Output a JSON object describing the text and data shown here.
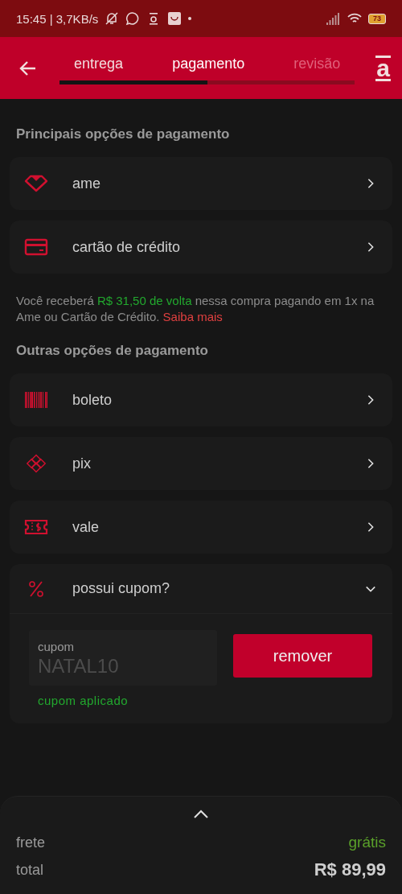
{
  "status_bar": {
    "time": "15:45 | 3,7KB/s",
    "battery": "73"
  },
  "header": {
    "logo": "a",
    "progress": {
      "level": 0.5
    },
    "steps": [
      {
        "label": "entrega",
        "selected": false,
        "disabled": false
      },
      {
        "label": "pagamento",
        "selected": true,
        "disabled": false
      },
      {
        "label": "revisão",
        "selected": false,
        "disabled": true
      }
    ]
  },
  "main_options": {
    "title": "Principais opções de pagamento",
    "items": [
      {
        "kind": "ame",
        "label": "ame"
      },
      {
        "kind": "card",
        "label": "cartão de crédito"
      }
    ]
  },
  "cashback": {
    "before": "Você receberá ",
    "highlight": "R$ 31,50 de volta",
    "after": " nessa compra pagando em 1x na Ame ou Cartão de Crédito.",
    "link": "Saiba mais"
  },
  "other_options": {
    "title": "Outras opções de pagamento",
    "items": [
      {
        "kind": "boleto",
        "label": "boleto"
      },
      {
        "kind": "pix",
        "label": "pix"
      },
      {
        "kind": "vale",
        "label": "vale"
      }
    ]
  },
  "coupon": {
    "label": "possui cupom?",
    "expanded": true,
    "field_label": "cupom",
    "value": "NATAL10",
    "button": "remover",
    "status": "cupom aplicado"
  },
  "summary": {
    "rows": [
      {
        "label": "frete",
        "value": "grátis",
        "kind": "free"
      },
      {
        "label": "total",
        "value": "R$ 89,99",
        "kind": "total"
      }
    ]
  }
}
